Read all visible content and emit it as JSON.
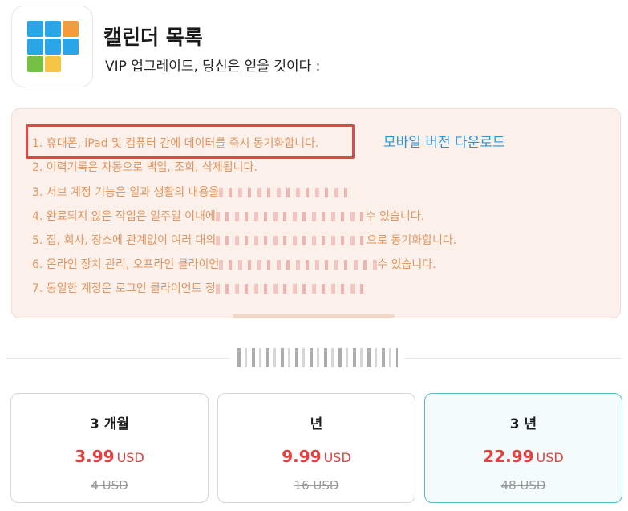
{
  "header": {
    "title": "캘린더 목록",
    "subtitle": "VIP 업그레이드, 당신은 얻을 것이다 :",
    "logo_icon": "calendar-grid-icon",
    "logo_colors": [
      "#2aa6e8",
      "#f39c3d",
      "#76c043",
      "#f7c544"
    ]
  },
  "features": {
    "items": [
      "1. 휴대폰, iPad 및 컴퓨터 간에 데이터를 즉시 동기화합니다.",
      "2. 이력기록은 자동으로 백업, 조회, 삭제됩니다.",
      "3. 서브 계정 기능은 일과 생활의 내용을",
      "4. 완료되지 않은 작업은 일주일 이내에",
      "5. 집, 회사, 장소에 관계없이 여러 대의",
      "6. 온라인 장치 관리, 오프라인 클라이언",
      "7. 동일한 계정은 로그인 클라이언트 정"
    ],
    "item_tails": [
      "",
      "",
      "",
      "수 있습니다.",
      "으로 동기화합니다.",
      "수 있습니다.",
      ""
    ],
    "download_link": "모바일 버전 다운로드"
  },
  "plans": [
    {
      "name": "3 개월",
      "price": "3.99",
      "currency": "USD",
      "old_price": "4 USD",
      "selected": false
    },
    {
      "name": "년",
      "price": "9.99",
      "currency": "USD",
      "old_price": "16 USD",
      "selected": false
    },
    {
      "name": "3 년",
      "price": "22.99",
      "currency": "USD",
      "old_price": "48 USD",
      "selected": true
    }
  ],
  "colors": {
    "feature_text": "#e39560",
    "feature_bg": "#fbf1ea",
    "highlight_border": "#e04848",
    "link": "#2b95d9",
    "price": "#e5413f",
    "selected_border": "#58b9cf"
  }
}
